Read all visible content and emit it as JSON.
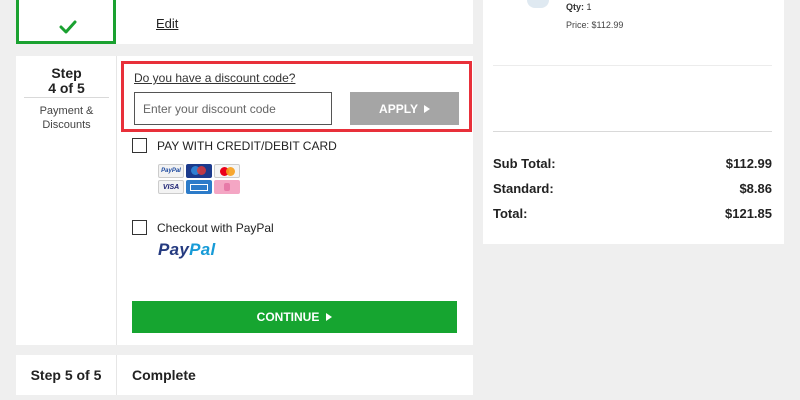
{
  "step3": {
    "edit_label": "Edit"
  },
  "step4": {
    "title": "Step\n4 of 5",
    "subtitle": "Payment &\nDiscounts",
    "discount": {
      "link_text": "Do you have a discount code?",
      "input_placeholder": "Enter your discount code",
      "input_value": "",
      "apply_label": "APPLY"
    },
    "payment_options": [
      {
        "label": "PAY WITH CREDIT/DEBIT CARD",
        "checked": false
      },
      {
        "label": "Checkout with PayPal",
        "checked": false
      }
    ],
    "card_icons": [
      "paypal-card-icon",
      "maestro-card-icon",
      "mastercard-icon",
      "visa-card-icon",
      "amex-card-icon",
      "klarna-card-icon"
    ],
    "card_icon_text": {
      "paypal": "PayPal",
      "visa": "VISA"
    },
    "paypal_logo": {
      "pay": "Pay",
      "pal": "Pal"
    },
    "continue_label": "CONTINUE"
  },
  "step5": {
    "title": "Step 5 of 5",
    "label": "Complete"
  },
  "summary": {
    "qty_label": "Qty:",
    "qty_value": "1",
    "price_text": "Price: $112.99",
    "subtotal_label": "Sub Total:",
    "subtotal_value": "$112.99",
    "shipping_label": "Standard:",
    "shipping_value": "$8.86",
    "total_label": "Total:",
    "total_value": "$121.85"
  },
  "colors": {
    "accent_green": "#16a530",
    "highlight_red": "#e8303a",
    "apply_gray": "#a5a5a5",
    "page_bg": "#efefef"
  }
}
